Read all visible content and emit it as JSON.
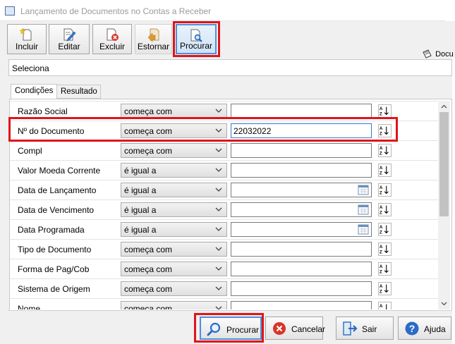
{
  "window": {
    "title": "Lançamento de Documentos no Contas a Receber"
  },
  "toolbar": {
    "incluir_label": "Incluir",
    "editar_label": "Editar",
    "excluir_label": "Excluir",
    "estornar_label": "Estornar",
    "procurar_label": "Procurar",
    "right_label": "Docu"
  },
  "dialog": {
    "title": "Seleciona",
    "tabs": [
      {
        "label": "Condições"
      },
      {
        "label": "Resultado"
      }
    ]
  },
  "conditions": [
    {
      "field": "Razão Social",
      "operator": "começa com",
      "value": ""
    },
    {
      "field": "Nº do Documento",
      "operator": "começa com",
      "value": "22032022"
    },
    {
      "field": "Compl",
      "operator": "começa com",
      "value": ""
    },
    {
      "field": "Valor Moeda Corrente",
      "operator": "é igual a",
      "value": ""
    },
    {
      "field": "Data de Lançamento",
      "operator": "é igual a",
      "value": ""
    },
    {
      "field": "Data de Vencimento",
      "operator": "é igual a",
      "value": ""
    },
    {
      "field": "Data Programada",
      "operator": "é igual a",
      "value": ""
    },
    {
      "field": "Tipo de Documento",
      "operator": "começa com",
      "value": ""
    },
    {
      "field": "Forma de Pag/Cob",
      "operator": "começa com",
      "value": ""
    },
    {
      "field": "Sistema de Origem",
      "operator": "começa com",
      "value": ""
    },
    {
      "field": "Nome",
      "operator": "começa com",
      "value": ""
    }
  ],
  "buttons": {
    "procurar_label": "Procurar",
    "cancelar_label": "Cancelar",
    "sair_label": "Sair",
    "ajuda_label": "Ajuda"
  },
  "colors": {
    "highlight": "#e0141b",
    "focus": "#2b7bd6",
    "cancel_red": "#d9342b",
    "help_blue": "#2b6cc4"
  }
}
